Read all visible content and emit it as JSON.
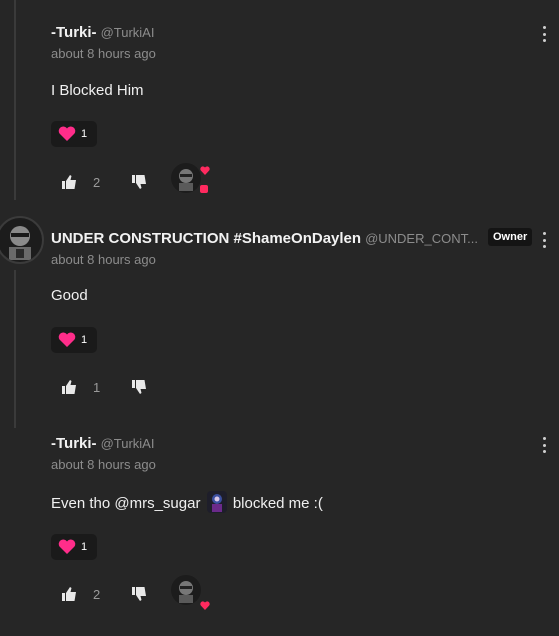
{
  "comments": [
    {
      "author": "-Turki-",
      "handle": "@TurkiAI",
      "time": "about 8 hours ago",
      "text": "I Blocked Him",
      "reaction_count": "1",
      "likes": "2"
    },
    {
      "author": "UNDER CONSTRUCTION #ShameOnDaylen",
      "handle": "@UNDER_CONT...",
      "badge": "Owner",
      "time": "about 8 hours ago",
      "text": "Good",
      "reaction_count": "1",
      "likes": "1"
    },
    {
      "author": "-Turki-",
      "handle": "@TurkiAI",
      "time": "about 8 hours ago",
      "text_before": "Even tho @mrs_sugar",
      "text_after": "blocked me :(",
      "reaction_count": "1",
      "likes": "2"
    }
  ],
  "colors": {
    "heart": "#ff2d8a",
    "background": "#262626",
    "muted": "#8c8c8c"
  },
  "icons": [
    "heart-icon",
    "thumbs-up-icon",
    "thumbs-down-icon",
    "more-vertical-icon"
  ]
}
